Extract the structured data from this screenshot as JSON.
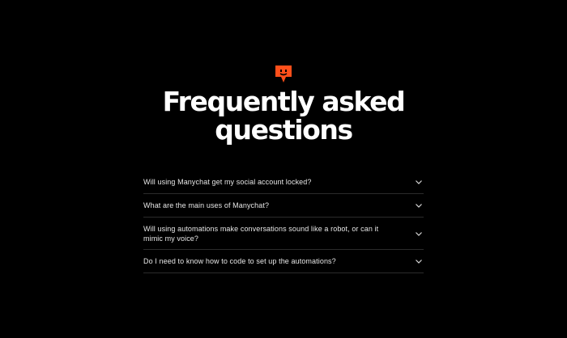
{
  "brand": {
    "accent_color": "#ff4f1a",
    "logo_icon": "chat-bubble-face-icon"
  },
  "header": {
    "title_line1": "Frequently asked",
    "title_line2": "questions"
  },
  "faq": {
    "items": [
      {
        "question": "Will using Manychat get my social account locked?",
        "icon": "chevron-down-icon"
      },
      {
        "question": "What are the main uses of Manychat?",
        "icon": "chevron-down-icon"
      },
      {
        "question": "Will using automations make conversations sound like a robot, or can it mimic my voice?",
        "icon": "chevron-down-icon"
      },
      {
        "question": "Do I need to know how to code to set up the automations?",
        "icon": "chevron-down-icon"
      }
    ]
  }
}
